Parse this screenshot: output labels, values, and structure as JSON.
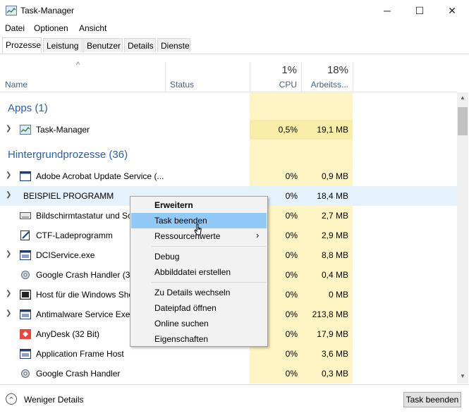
{
  "window": {
    "title": "Task-Manager",
    "minimize": "─",
    "maximize": "☐",
    "close": "✕"
  },
  "menu": [
    "Datei",
    "Optionen",
    "Ansicht"
  ],
  "tabs": [
    "Prozesse",
    "Leistung",
    "Benutzer",
    "Details",
    "Dienste"
  ],
  "header": {
    "sort_arrow": "^",
    "name": "Name",
    "status": "Status",
    "cpu_percent": "1%",
    "cpu": "CPU",
    "mem_percent": "18%",
    "mem": "Arbeitss..."
  },
  "groups": {
    "apps": "Apps (1)",
    "background": "Hintergrundprozesse (36)"
  },
  "rows": [
    {
      "name": "Task-Manager",
      "cpu": "0,5%",
      "mem": "19,1 MB",
      "expandable": true,
      "icon": "taskmanager-icon"
    },
    {
      "name": "Adobe Acrobat Update Service (...",
      "cpu": "0%",
      "mem": "0,9 MB",
      "expandable": true,
      "icon": "window-icon"
    },
    {
      "name": "BEISPIEL PROGRAMM",
      "cpu": "0%",
      "mem": "18,4 MB",
      "expandable": true,
      "icon": ""
    },
    {
      "name": "Bildschirmtastatur und Sc",
      "cpu": "0%",
      "mem": "2,7 MB",
      "expandable": false,
      "icon": "keyboard-icon"
    },
    {
      "name": "CTF-Ladeprogramm",
      "cpu": "0%",
      "mem": "2,9 MB",
      "expandable": false,
      "icon": "ctf-icon"
    },
    {
      "name": "DCIService.exe",
      "cpu": "0%",
      "mem": "8,8 MB",
      "expandable": true,
      "icon": "window-icon"
    },
    {
      "name": "Google Crash Handler (32",
      "cpu": "0%",
      "mem": "0,4 MB",
      "expandable": false,
      "icon": "gear-icon"
    },
    {
      "name": "Host für die Windows She",
      "cpu": "0%",
      "mem": "0 MB",
      "expandable": true,
      "icon": "host-icon"
    },
    {
      "name": "Antimalware Service Exec",
      "cpu": "0%",
      "mem": "213,8 MB",
      "expandable": true,
      "icon": "window-icon"
    },
    {
      "name": "AnyDesk (32 Bit)",
      "cpu": "0%",
      "mem": "17,9 MB",
      "expandable": false,
      "icon": "anydesk-icon"
    },
    {
      "name": "Application Frame Host",
      "cpu": "0%",
      "mem": "3,6 MB",
      "expandable": false,
      "icon": "window-icon"
    },
    {
      "name": "Google Crash Handler",
      "cpu": "0%",
      "mem": "0,3 MB",
      "expandable": false,
      "icon": "gear-icon"
    }
  ],
  "context_menu": {
    "items": [
      "Erweitern",
      "Task beenden",
      "Ressourcenwerte",
      "Debug",
      "Abbilddatei erstellen",
      "Zu Details wechseln",
      "Dateipfad öffnen",
      "Online suchen",
      "Eigenschaften"
    ],
    "submenu_arrow": "›"
  },
  "footer": {
    "fewer_details": "Weniger Details",
    "end_task": "Task beenden",
    "collapse_icon": "⌃"
  },
  "colors": {
    "accent": "#2a5fa8",
    "cpu_bg": "#fff4c4",
    "cpu_bg_active": "#f9eca8",
    "row_selected": "#cce8ff",
    "menu_hl": "#91c9f7"
  }
}
